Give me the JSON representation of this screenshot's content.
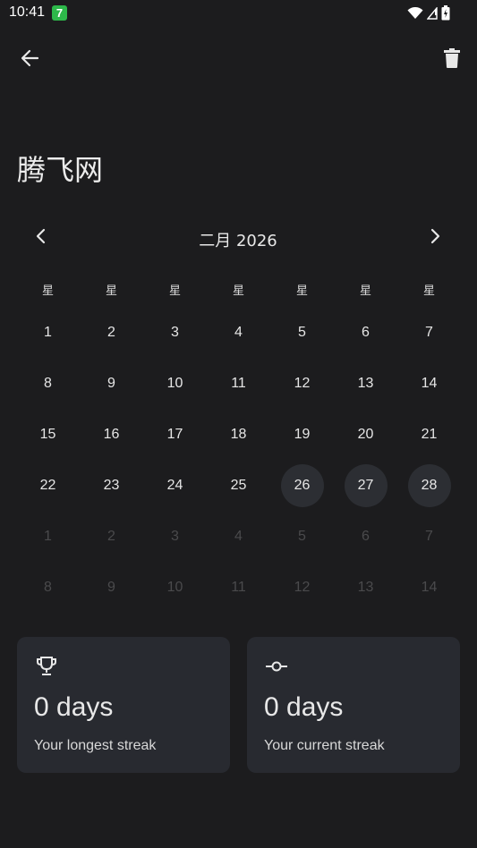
{
  "status_bar": {
    "time": "10:41",
    "notification_badge": "7",
    "icons": [
      "wifi-icon",
      "signal-icon",
      "battery-icon"
    ]
  },
  "header": {
    "back_icon": "arrow-back-icon",
    "delete_icon": "trash-icon"
  },
  "habit": {
    "title": "腾飞网"
  },
  "calendar": {
    "month_label": "二月 2026",
    "prev_icon": "chevron-left-icon",
    "next_icon": "chevron-right-icon",
    "weekdays": [
      "星",
      "星",
      "星",
      "星",
      "星",
      "星",
      "星"
    ],
    "days": [
      {
        "label": "1",
        "state": "normal"
      },
      {
        "label": "2",
        "state": "normal"
      },
      {
        "label": "3",
        "state": "normal"
      },
      {
        "label": "4",
        "state": "normal"
      },
      {
        "label": "5",
        "state": "normal"
      },
      {
        "label": "6",
        "state": "normal"
      },
      {
        "label": "7",
        "state": "normal"
      },
      {
        "label": "8",
        "state": "normal"
      },
      {
        "label": "9",
        "state": "normal"
      },
      {
        "label": "10",
        "state": "normal"
      },
      {
        "label": "11",
        "state": "normal"
      },
      {
        "label": "12",
        "state": "normal"
      },
      {
        "label": "13",
        "state": "normal"
      },
      {
        "label": "14",
        "state": "normal"
      },
      {
        "label": "15",
        "state": "normal"
      },
      {
        "label": "16",
        "state": "normal"
      },
      {
        "label": "17",
        "state": "normal"
      },
      {
        "label": "18",
        "state": "normal"
      },
      {
        "label": "19",
        "state": "normal"
      },
      {
        "label": "20",
        "state": "normal"
      },
      {
        "label": "21",
        "state": "normal"
      },
      {
        "label": "22",
        "state": "normal"
      },
      {
        "label": "23",
        "state": "normal"
      },
      {
        "label": "24",
        "state": "normal"
      },
      {
        "label": "25",
        "state": "normal"
      },
      {
        "label": "26",
        "state": "highlight"
      },
      {
        "label": "27",
        "state": "highlight"
      },
      {
        "label": "28",
        "state": "highlight"
      },
      {
        "label": "1",
        "state": "other"
      },
      {
        "label": "2",
        "state": "other"
      },
      {
        "label": "3",
        "state": "other"
      },
      {
        "label": "4",
        "state": "other"
      },
      {
        "label": "5",
        "state": "other"
      },
      {
        "label": "6",
        "state": "other"
      },
      {
        "label": "7",
        "state": "other"
      },
      {
        "label": "8",
        "state": "other"
      },
      {
        "label": "9",
        "state": "other"
      },
      {
        "label": "10",
        "state": "other"
      },
      {
        "label": "11",
        "state": "other"
      },
      {
        "label": "12",
        "state": "other"
      },
      {
        "label": "13",
        "state": "other"
      },
      {
        "label": "14",
        "state": "other"
      }
    ]
  },
  "stats": {
    "longest": {
      "icon": "trophy-icon",
      "value": "0 days",
      "label": "Your longest streak"
    },
    "current": {
      "icon": "commit-icon",
      "value": "0 days",
      "label": "Your current streak"
    }
  },
  "colors": {
    "background": "#1c1c1e",
    "card": "#282a30",
    "highlight_day": "#2c2e33",
    "notification_badge": "#2db84a"
  }
}
